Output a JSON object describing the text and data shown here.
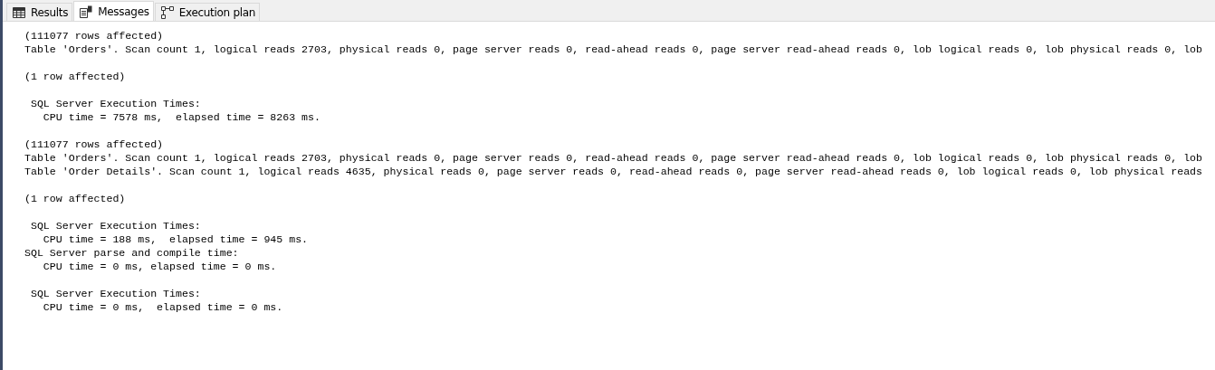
{
  "tabs": [
    {
      "label": "Results",
      "kind": "grid",
      "selected": false
    },
    {
      "label": "Messages",
      "kind": "messages",
      "selected": true
    },
    {
      "label": "Execution plan",
      "kind": "plan",
      "selected": false
    }
  ],
  "messages": [
    {
      "lines": [
        "(111077 rows affected)",
        "Table 'Orders'. Scan count 1, logical reads 2703, physical reads 0, page server reads 0, read-ahead reads 0, page server read-ahead reads 0, lob logical reads 0, lob physical reads 0, lob"
      ]
    },
    {
      "lines": [
        "(1 row affected)"
      ]
    },
    {
      "lines": [
        " SQL Server Execution Times:",
        "   CPU time = 7578 ms,  elapsed time = 8263 ms."
      ]
    },
    {
      "lines": [
        "(111077 rows affected)",
        "Table 'Orders'. Scan count 1, logical reads 2703, physical reads 0, page server reads 0, read-ahead reads 0, page server read-ahead reads 0, lob logical reads 0, lob physical reads 0, lob",
        "Table 'Order Details'. Scan count 1, logical reads 4635, physical reads 0, page server reads 0, read-ahead reads 0, page server read-ahead reads 0, lob logical reads 0, lob physical reads"
      ]
    },
    {
      "lines": [
        "(1 row affected)"
      ]
    },
    {
      "lines": [
        " SQL Server Execution Times:",
        "   CPU time = 188 ms,  elapsed time = 945 ms.",
        "SQL Server parse and compile time:",
        "   CPU time = 0 ms, elapsed time = 0 ms."
      ]
    },
    {
      "lines": [
        " SQL Server Execution Times:",
        "   CPU time = 0 ms,  elapsed time = 0 ms."
      ]
    }
  ]
}
